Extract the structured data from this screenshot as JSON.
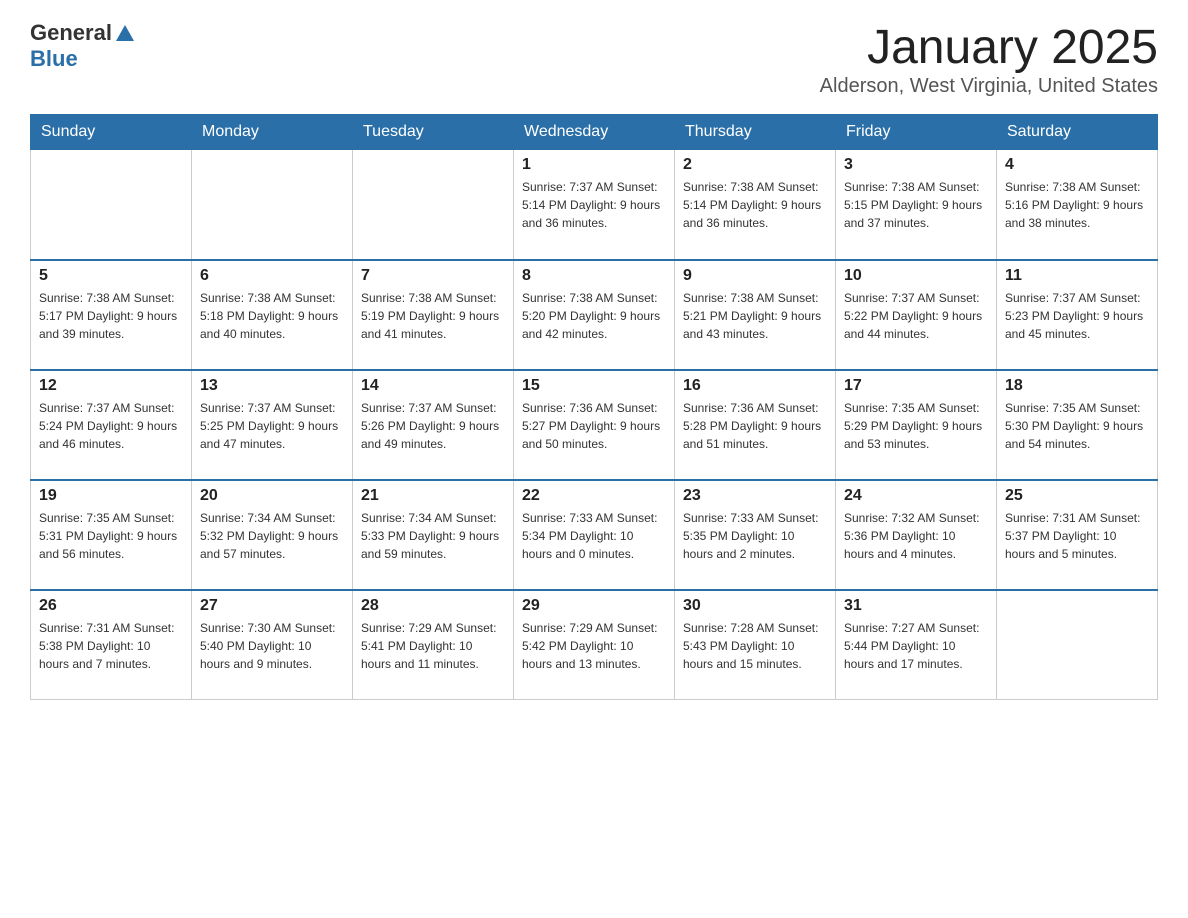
{
  "header": {
    "logo_general": "General",
    "logo_blue": "Blue",
    "title": "January 2025",
    "subtitle": "Alderson, West Virginia, United States"
  },
  "days_of_week": [
    "Sunday",
    "Monday",
    "Tuesday",
    "Wednesday",
    "Thursday",
    "Friday",
    "Saturday"
  ],
  "weeks": [
    [
      {
        "day": "",
        "info": ""
      },
      {
        "day": "",
        "info": ""
      },
      {
        "day": "",
        "info": ""
      },
      {
        "day": "1",
        "info": "Sunrise: 7:37 AM\nSunset: 5:14 PM\nDaylight: 9 hours\nand 36 minutes."
      },
      {
        "day": "2",
        "info": "Sunrise: 7:38 AM\nSunset: 5:14 PM\nDaylight: 9 hours\nand 36 minutes."
      },
      {
        "day": "3",
        "info": "Sunrise: 7:38 AM\nSunset: 5:15 PM\nDaylight: 9 hours\nand 37 minutes."
      },
      {
        "day": "4",
        "info": "Sunrise: 7:38 AM\nSunset: 5:16 PM\nDaylight: 9 hours\nand 38 minutes."
      }
    ],
    [
      {
        "day": "5",
        "info": "Sunrise: 7:38 AM\nSunset: 5:17 PM\nDaylight: 9 hours\nand 39 minutes."
      },
      {
        "day": "6",
        "info": "Sunrise: 7:38 AM\nSunset: 5:18 PM\nDaylight: 9 hours\nand 40 minutes."
      },
      {
        "day": "7",
        "info": "Sunrise: 7:38 AM\nSunset: 5:19 PM\nDaylight: 9 hours\nand 41 minutes."
      },
      {
        "day": "8",
        "info": "Sunrise: 7:38 AM\nSunset: 5:20 PM\nDaylight: 9 hours\nand 42 minutes."
      },
      {
        "day": "9",
        "info": "Sunrise: 7:38 AM\nSunset: 5:21 PM\nDaylight: 9 hours\nand 43 minutes."
      },
      {
        "day": "10",
        "info": "Sunrise: 7:37 AM\nSunset: 5:22 PM\nDaylight: 9 hours\nand 44 minutes."
      },
      {
        "day": "11",
        "info": "Sunrise: 7:37 AM\nSunset: 5:23 PM\nDaylight: 9 hours\nand 45 minutes."
      }
    ],
    [
      {
        "day": "12",
        "info": "Sunrise: 7:37 AM\nSunset: 5:24 PM\nDaylight: 9 hours\nand 46 minutes."
      },
      {
        "day": "13",
        "info": "Sunrise: 7:37 AM\nSunset: 5:25 PM\nDaylight: 9 hours\nand 47 minutes."
      },
      {
        "day": "14",
        "info": "Sunrise: 7:37 AM\nSunset: 5:26 PM\nDaylight: 9 hours\nand 49 minutes."
      },
      {
        "day": "15",
        "info": "Sunrise: 7:36 AM\nSunset: 5:27 PM\nDaylight: 9 hours\nand 50 minutes."
      },
      {
        "day": "16",
        "info": "Sunrise: 7:36 AM\nSunset: 5:28 PM\nDaylight: 9 hours\nand 51 minutes."
      },
      {
        "day": "17",
        "info": "Sunrise: 7:35 AM\nSunset: 5:29 PM\nDaylight: 9 hours\nand 53 minutes."
      },
      {
        "day": "18",
        "info": "Sunrise: 7:35 AM\nSunset: 5:30 PM\nDaylight: 9 hours\nand 54 minutes."
      }
    ],
    [
      {
        "day": "19",
        "info": "Sunrise: 7:35 AM\nSunset: 5:31 PM\nDaylight: 9 hours\nand 56 minutes."
      },
      {
        "day": "20",
        "info": "Sunrise: 7:34 AM\nSunset: 5:32 PM\nDaylight: 9 hours\nand 57 minutes."
      },
      {
        "day": "21",
        "info": "Sunrise: 7:34 AM\nSunset: 5:33 PM\nDaylight: 9 hours\nand 59 minutes."
      },
      {
        "day": "22",
        "info": "Sunrise: 7:33 AM\nSunset: 5:34 PM\nDaylight: 10 hours\nand 0 minutes."
      },
      {
        "day": "23",
        "info": "Sunrise: 7:33 AM\nSunset: 5:35 PM\nDaylight: 10 hours\nand 2 minutes."
      },
      {
        "day": "24",
        "info": "Sunrise: 7:32 AM\nSunset: 5:36 PM\nDaylight: 10 hours\nand 4 minutes."
      },
      {
        "day": "25",
        "info": "Sunrise: 7:31 AM\nSunset: 5:37 PM\nDaylight: 10 hours\nand 5 minutes."
      }
    ],
    [
      {
        "day": "26",
        "info": "Sunrise: 7:31 AM\nSunset: 5:38 PM\nDaylight: 10 hours\nand 7 minutes."
      },
      {
        "day": "27",
        "info": "Sunrise: 7:30 AM\nSunset: 5:40 PM\nDaylight: 10 hours\nand 9 minutes."
      },
      {
        "day": "28",
        "info": "Sunrise: 7:29 AM\nSunset: 5:41 PM\nDaylight: 10 hours\nand 11 minutes."
      },
      {
        "day": "29",
        "info": "Sunrise: 7:29 AM\nSunset: 5:42 PM\nDaylight: 10 hours\nand 13 minutes."
      },
      {
        "day": "30",
        "info": "Sunrise: 7:28 AM\nSunset: 5:43 PM\nDaylight: 10 hours\nand 15 minutes."
      },
      {
        "day": "31",
        "info": "Sunrise: 7:27 AM\nSunset: 5:44 PM\nDaylight: 10 hours\nand 17 minutes."
      },
      {
        "day": "",
        "info": ""
      }
    ]
  ]
}
